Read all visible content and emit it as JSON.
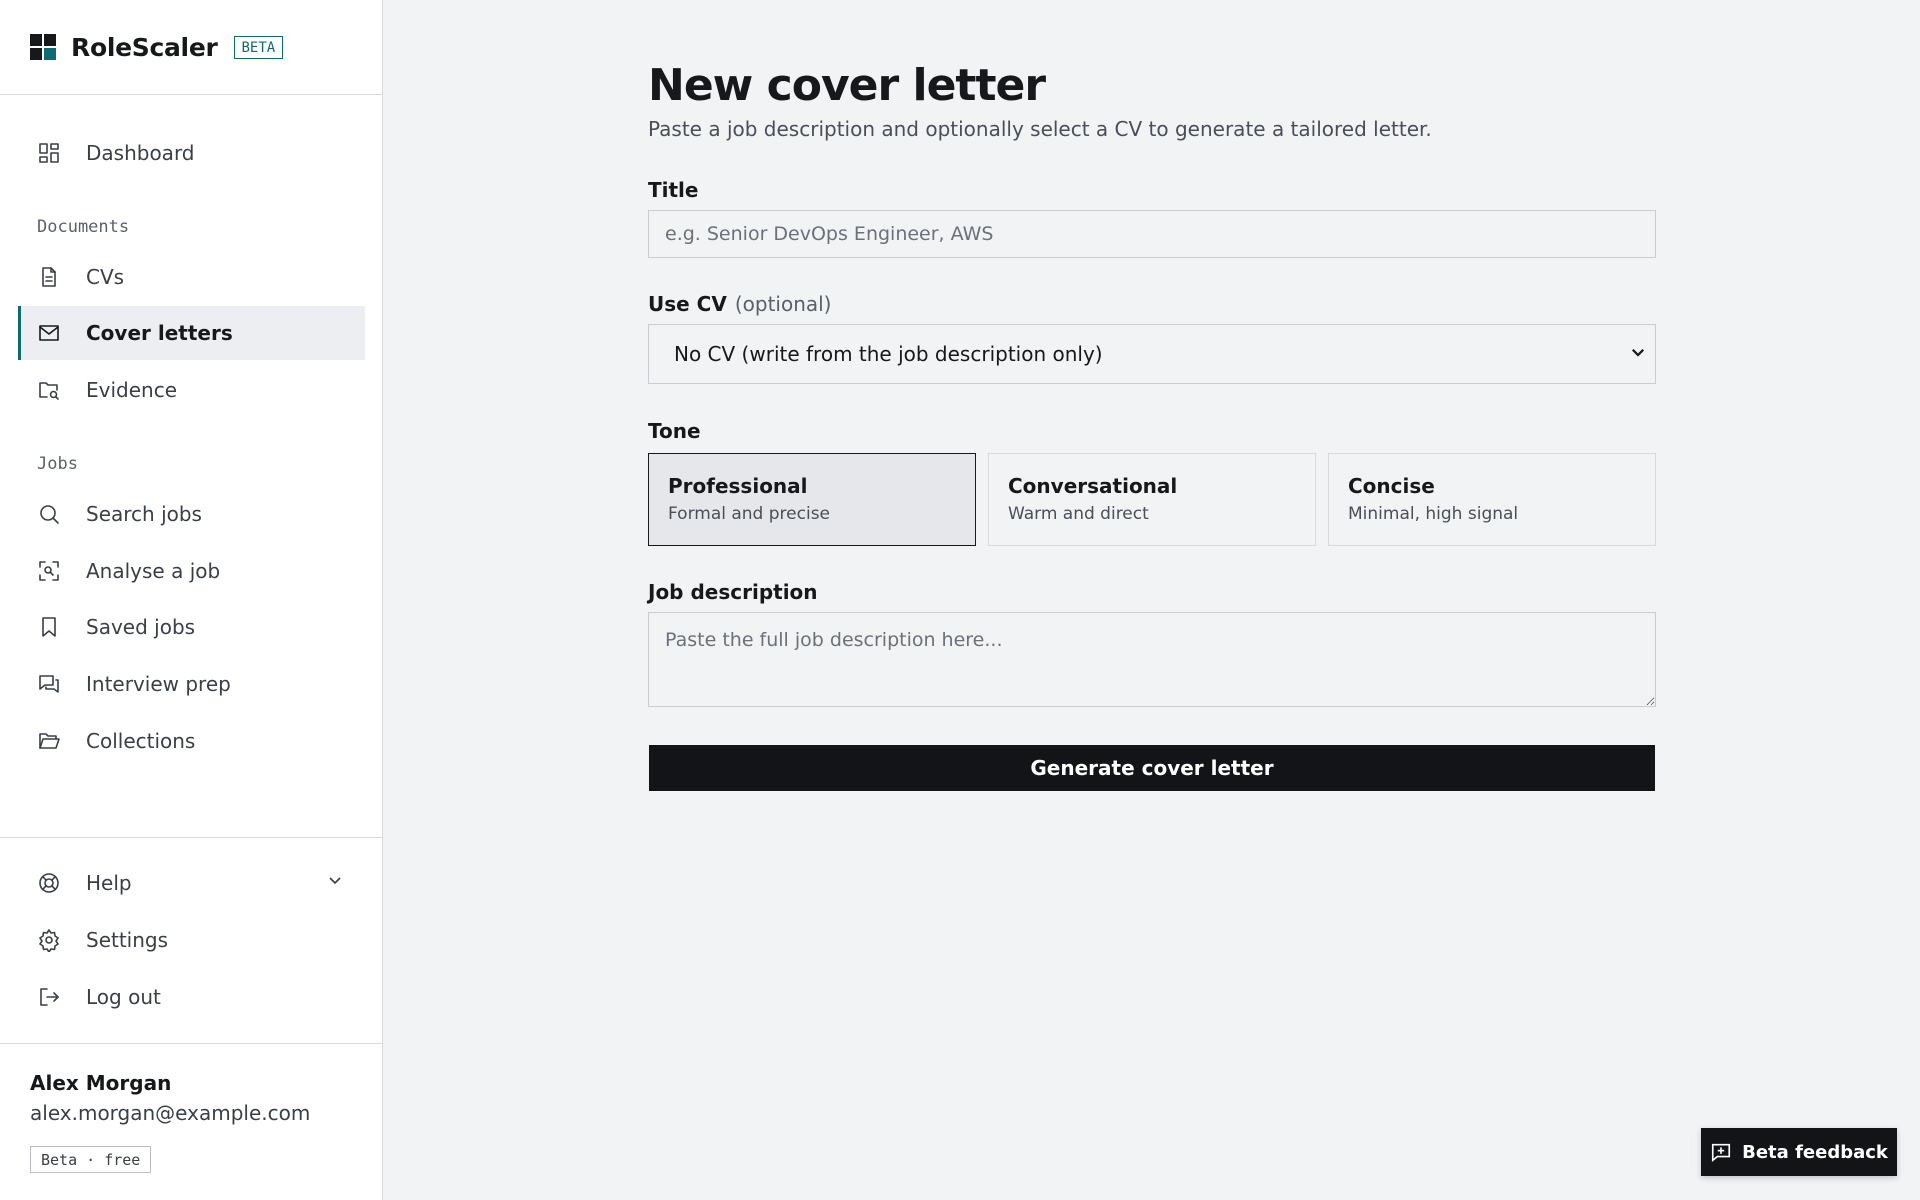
{
  "brand": {
    "name": "RoleScaler",
    "badge": "BETA"
  },
  "sidebar": {
    "dashboard": "Dashboard",
    "documents_label": "Documents",
    "documents": [
      "CVs",
      "Cover letters",
      "Evidence"
    ],
    "jobs_label": "Jobs",
    "jobs": [
      "Search jobs",
      "Analyse a job",
      "Saved jobs",
      "Interview prep",
      "Collections"
    ],
    "footer": [
      "Help",
      "Settings",
      "Log out"
    ],
    "active_item": "Cover letters",
    "accent_color": "#0f6b72"
  },
  "user": {
    "name": "Alex Morgan",
    "email": "alex.morgan@example.com",
    "plan": "Beta · free"
  },
  "page": {
    "title": "New cover letter",
    "subtitle": "Paste a job description and optionally select a CV to generate a tailored letter."
  },
  "form": {
    "title_label": "Title",
    "title_placeholder": "e.g. Senior DevOps Engineer, AWS",
    "title_value": "",
    "cv_label": "Use CV",
    "cv_optional": "(optional)",
    "cv_selected": "No CV (write from the job description only)",
    "tone_label": "Tone",
    "tones": [
      {
        "title": "Professional",
        "desc": "Formal and precise",
        "selected": true
      },
      {
        "title": "Conversational",
        "desc": "Warm and direct",
        "selected": false
      },
      {
        "title": "Concise",
        "desc": "Minimal, high signal",
        "selected": false
      }
    ],
    "jd_label": "Job description",
    "jd_placeholder": "Paste the full job description here...",
    "jd_value": "",
    "generate_label": "Generate cover letter"
  },
  "feedback": {
    "label": "Beta feedback"
  }
}
